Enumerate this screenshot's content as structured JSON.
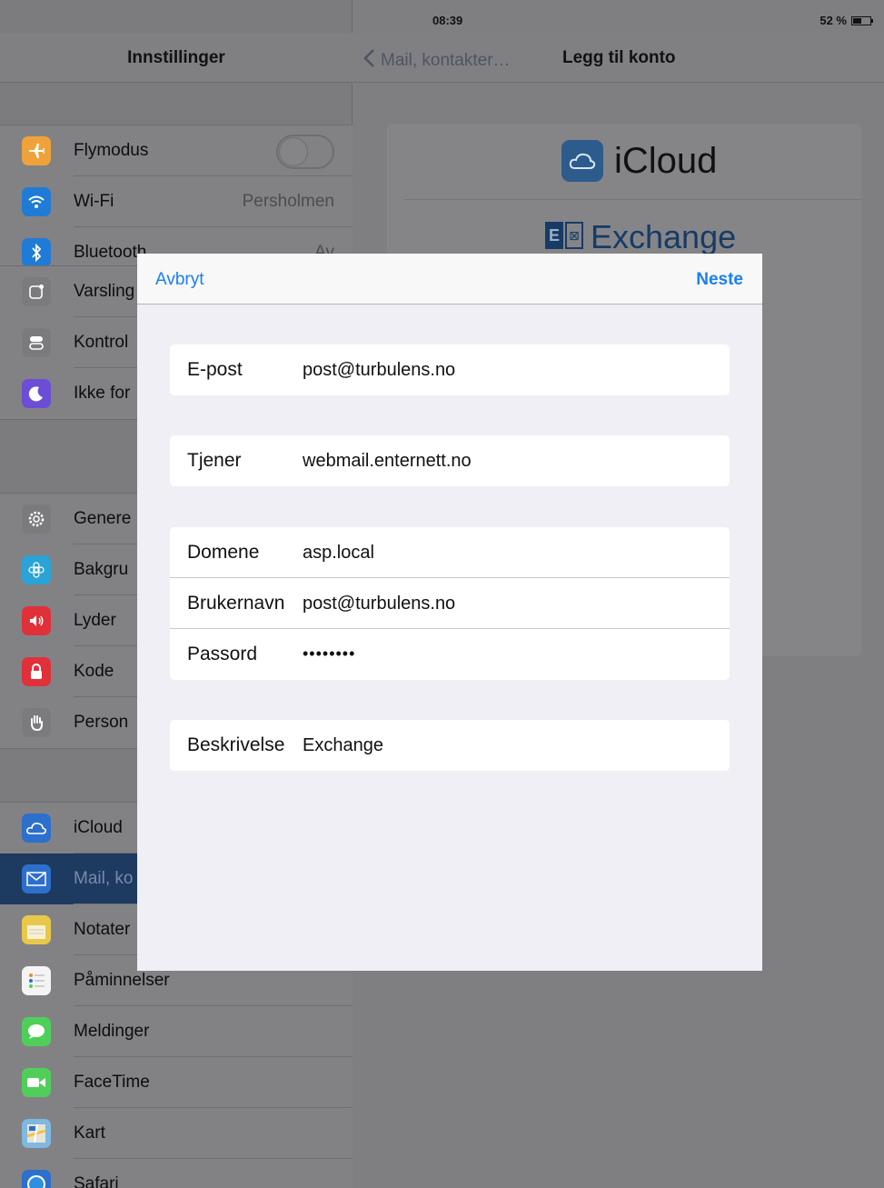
{
  "status_bar": {
    "device": "iPad",
    "wifi_icon": "wifi-icon",
    "time": "08:39",
    "battery": "52 %",
    "battery_level_percent": 52
  },
  "master": {
    "title": "Innstillinger",
    "groups": [
      {
        "items": [
          {
            "label": "Flymodus",
            "icon": "airplane-icon",
            "color": "#f0a23a",
            "control": "toggle",
            "toggle_on": false
          },
          {
            "label": "Wi-Fi",
            "icon": "wifi-icon",
            "color": "#1f7bd6",
            "value": "Persholmen"
          },
          {
            "label": "Bluetooth",
            "icon": "bluetooth-icon",
            "color": "#1f7bd6",
            "value": "Av"
          }
        ]
      },
      {
        "items": [
          {
            "label": "Varsling",
            "icon": "notifications-icon",
            "color": "#7b7b7e"
          },
          {
            "label": "Kontrol",
            "icon": "control-center-icon",
            "color": "#7b7b7e"
          },
          {
            "label": "Ikke for",
            "icon": "moon-icon",
            "color": "#6c4ed6"
          }
        ]
      },
      {
        "items": [
          {
            "label": "Genere",
            "icon": "gear-icon",
            "color": "#7b7b7e"
          },
          {
            "label": "Bakgru",
            "icon": "wallpaper-icon",
            "color": "#2aa3d6"
          },
          {
            "label": "Lyder",
            "icon": "speaker-icon",
            "color": "#e0303a"
          },
          {
            "label": "Kode",
            "icon": "lock-icon",
            "color": "#e0303a"
          },
          {
            "label": "Person",
            "icon": "hand-icon",
            "color": "#7b7b7e"
          }
        ]
      },
      {
        "items": [
          {
            "label": "iCloud",
            "icon": "cloud-icon",
            "color": "#2d6fcc"
          },
          {
            "label": "Mail, ko",
            "icon": "mail-icon",
            "color": "#2d6fcc",
            "selected": true
          },
          {
            "label": "Notater",
            "icon": "notes-icon",
            "color": "#e8c84a"
          },
          {
            "label": "Påminnelser",
            "icon": "reminders-icon",
            "color": "#f4f4f4"
          },
          {
            "label": "Meldinger",
            "icon": "messages-icon",
            "color": "#4fcf5a"
          },
          {
            "label": "FaceTime",
            "icon": "facetime-icon",
            "color": "#4fcf5a"
          },
          {
            "label": "Kart",
            "icon": "maps-icon",
            "color": "#7fb8e0"
          },
          {
            "label": "Safari",
            "icon": "safari-icon",
            "color": "#2d6fcc"
          }
        ]
      }
    ]
  },
  "detail": {
    "back_label": "Mail, kontakter…",
    "title": "Legg til konto",
    "accounts": {
      "icloud": "iCloud",
      "exchange": "Exchange",
      "exchange_logo_letters": [
        "E",
        "⊠"
      ]
    }
  },
  "modal": {
    "cancel_label": "Avbryt",
    "next_label": "Neste",
    "groups": [
      [
        {
          "label": "E-post",
          "value": "post@turbulens.no"
        }
      ],
      [
        {
          "label": "Tjener",
          "value": "webmail.enternett.no"
        }
      ],
      [
        {
          "label": "Domene",
          "value": "asp.local"
        },
        {
          "label": "Brukernavn",
          "value": "post@turbulens.no"
        },
        {
          "label": "Passord",
          "value": "••••••••",
          "secure": true
        }
      ],
      [
        {
          "label": "Beskrivelse",
          "value": "Exchange"
        }
      ]
    ]
  }
}
